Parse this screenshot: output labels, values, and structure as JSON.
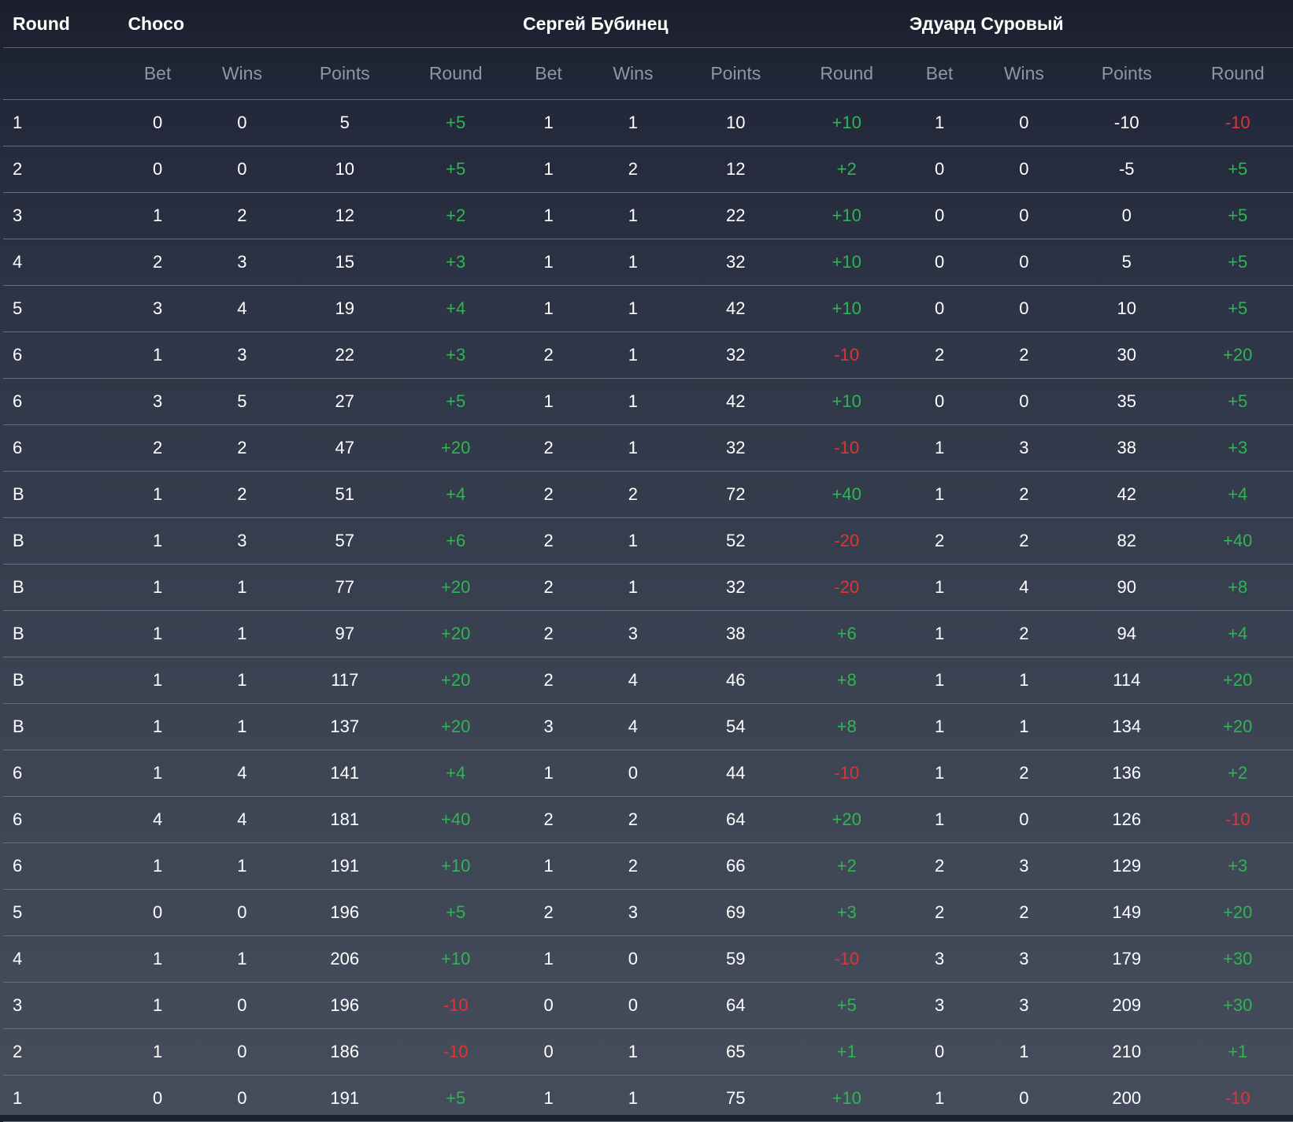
{
  "header": {
    "round_label": "Round",
    "players": [
      "Choco",
      "Сергей Бубинец",
      "Эдуард Суровый"
    ],
    "subcolumns": [
      "Bet",
      "Wins",
      "Points",
      "Round"
    ]
  },
  "rows": [
    {
      "round": "1",
      "p": [
        [
          "0",
          "0",
          "5",
          "+5"
        ],
        [
          "1",
          "1",
          "10",
          "+10"
        ],
        [
          "1",
          "0",
          "-10",
          "-10"
        ]
      ]
    },
    {
      "round": "2",
      "p": [
        [
          "0",
          "0",
          "10",
          "+5"
        ],
        [
          "1",
          "2",
          "12",
          "+2"
        ],
        [
          "0",
          "0",
          "-5",
          "+5"
        ]
      ]
    },
    {
      "round": "3",
      "p": [
        [
          "1",
          "2",
          "12",
          "+2"
        ],
        [
          "1",
          "1",
          "22",
          "+10"
        ],
        [
          "0",
          "0",
          "0",
          "+5"
        ]
      ]
    },
    {
      "round": "4",
      "p": [
        [
          "2",
          "3",
          "15",
          "+3"
        ],
        [
          "1",
          "1",
          "32",
          "+10"
        ],
        [
          "0",
          "0",
          "5",
          "+5"
        ]
      ]
    },
    {
      "round": "5",
      "p": [
        [
          "3",
          "4",
          "19",
          "+4"
        ],
        [
          "1",
          "1",
          "42",
          "+10"
        ],
        [
          "0",
          "0",
          "10",
          "+5"
        ]
      ]
    },
    {
      "round": "6",
      "p": [
        [
          "1",
          "3",
          "22",
          "+3"
        ],
        [
          "2",
          "1",
          "32",
          "-10"
        ],
        [
          "2",
          "2",
          "30",
          "+20"
        ]
      ]
    },
    {
      "round": "6",
      "p": [
        [
          "3",
          "5",
          "27",
          "+5"
        ],
        [
          "1",
          "1",
          "42",
          "+10"
        ],
        [
          "0",
          "0",
          "35",
          "+5"
        ]
      ]
    },
    {
      "round": "6",
      "p": [
        [
          "2",
          "2",
          "47",
          "+20"
        ],
        [
          "2",
          "1",
          "32",
          "-10"
        ],
        [
          "1",
          "3",
          "38",
          "+3"
        ]
      ]
    },
    {
      "round": "B",
      "p": [
        [
          "1",
          "2",
          "51",
          "+4"
        ],
        [
          "2",
          "2",
          "72",
          "+40"
        ],
        [
          "1",
          "2",
          "42",
          "+4"
        ]
      ]
    },
    {
      "round": "B",
      "p": [
        [
          "1",
          "3",
          "57",
          "+6"
        ],
        [
          "2",
          "1",
          "52",
          "-20"
        ],
        [
          "2",
          "2",
          "82",
          "+40"
        ]
      ]
    },
    {
      "round": "B",
      "p": [
        [
          "1",
          "1",
          "77",
          "+20"
        ],
        [
          "2",
          "1",
          "32",
          "-20"
        ],
        [
          "1",
          "4",
          "90",
          "+8"
        ]
      ]
    },
    {
      "round": "B",
      "p": [
        [
          "1",
          "1",
          "97",
          "+20"
        ],
        [
          "2",
          "3",
          "38",
          "+6"
        ],
        [
          "1",
          "2",
          "94",
          "+4"
        ]
      ]
    },
    {
      "round": "B",
      "p": [
        [
          "1",
          "1",
          "117",
          "+20"
        ],
        [
          "2",
          "4",
          "46",
          "+8"
        ],
        [
          "1",
          "1",
          "114",
          "+20"
        ]
      ]
    },
    {
      "round": "B",
      "p": [
        [
          "1",
          "1",
          "137",
          "+20"
        ],
        [
          "3",
          "4",
          "54",
          "+8"
        ],
        [
          "1",
          "1",
          "134",
          "+20"
        ]
      ]
    },
    {
      "round": "6",
      "p": [
        [
          "1",
          "4",
          "141",
          "+4"
        ],
        [
          "1",
          "0",
          "44",
          "-10"
        ],
        [
          "1",
          "2",
          "136",
          "+2"
        ]
      ]
    },
    {
      "round": "6",
      "p": [
        [
          "4",
          "4",
          "181",
          "+40"
        ],
        [
          "2",
          "2",
          "64",
          "+20"
        ],
        [
          "1",
          "0",
          "126",
          "-10"
        ]
      ]
    },
    {
      "round": "6",
      "p": [
        [
          "1",
          "1",
          "191",
          "+10"
        ],
        [
          "1",
          "2",
          "66",
          "+2"
        ],
        [
          "2",
          "3",
          "129",
          "+3"
        ]
      ]
    },
    {
      "round": "5",
      "p": [
        [
          "0",
          "0",
          "196",
          "+5"
        ],
        [
          "2",
          "3",
          "69",
          "+3"
        ],
        [
          "2",
          "2",
          "149",
          "+20"
        ]
      ]
    },
    {
      "round": "4",
      "p": [
        [
          "1",
          "1",
          "206",
          "+10"
        ],
        [
          "1",
          "0",
          "59",
          "-10"
        ],
        [
          "3",
          "3",
          "179",
          "+30"
        ]
      ]
    },
    {
      "round": "3",
      "p": [
        [
          "1",
          "0",
          "196",
          "-10"
        ],
        [
          "0",
          "0",
          "64",
          "+5"
        ],
        [
          "3",
          "3",
          "209",
          "+30"
        ]
      ]
    },
    {
      "round": "2",
      "p": [
        [
          "1",
          "0",
          "186",
          "-10"
        ],
        [
          "0",
          "1",
          "65",
          "+1"
        ],
        [
          "0",
          "1",
          "210",
          "+1"
        ]
      ]
    },
    {
      "round": "1",
      "p": [
        [
          "0",
          "0",
          "191",
          "+5"
        ],
        [
          "1",
          "1",
          "75",
          "+10"
        ],
        [
          "1",
          "0",
          "200",
          "-10"
        ]
      ]
    }
  ],
  "colors": {
    "positive": "#2fb552",
    "negative": "#e03434"
  }
}
